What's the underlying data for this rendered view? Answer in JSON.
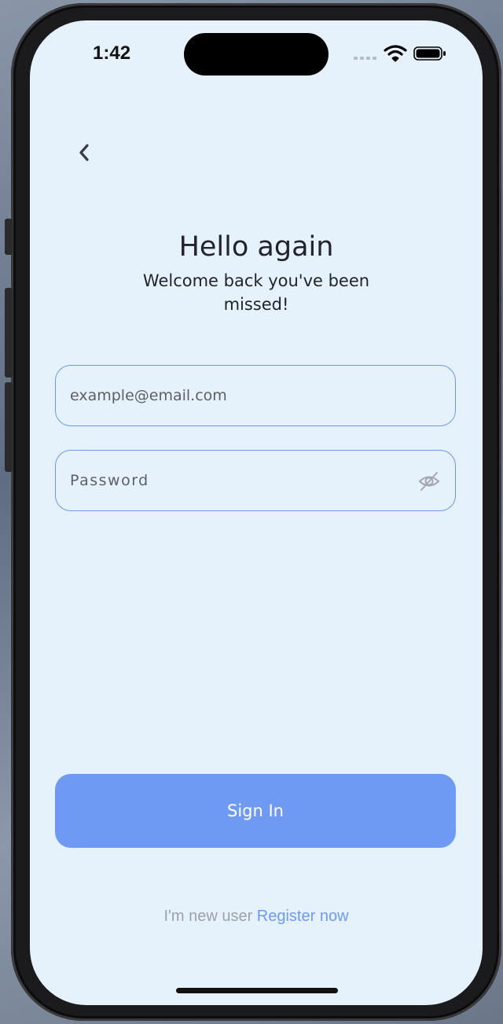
{
  "status_bar": {
    "time": "1:42"
  },
  "header": {
    "title": "Hello again",
    "subtitle": "Welcome back you've been missed!"
  },
  "form": {
    "email_placeholder": "example@email.com",
    "password_placeholder": "Password",
    "signin_label": "Sign In"
  },
  "footer": {
    "prompt": "I'm new user",
    "register_label": "Register now"
  },
  "colors": {
    "accent": "#6f9af4",
    "background": "#e6f2fb",
    "text": "#23232b",
    "field_border": "#6e97ea"
  },
  "icons": [
    "back-chevron-icon",
    "wifi-icon",
    "battery-icon",
    "eye-off-icon"
  ]
}
